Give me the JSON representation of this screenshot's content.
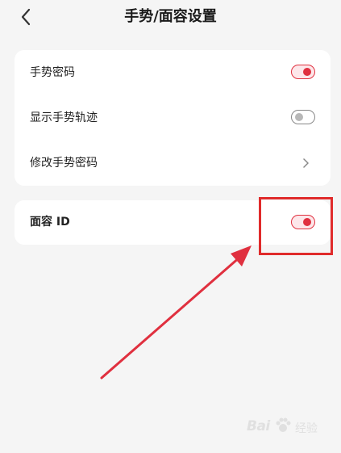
{
  "header": {
    "title": "手势/面容设置",
    "back_icon": "chevron-left-icon"
  },
  "settings": {
    "gesture_password": {
      "label": "手势密码",
      "toggle": "on"
    },
    "show_gesture_trail": {
      "label": "显示手势轨迹",
      "toggle": "off"
    },
    "change_gesture_password": {
      "label": "修改手势密码",
      "icon": "chevron-right-icon"
    },
    "face_id": {
      "label": "面容 ID",
      "toggle": "on"
    }
  },
  "annotation": {
    "highlight_color": "#e02b2b",
    "arrow_color": "#e0303f"
  },
  "watermark": {
    "brand": "Bai",
    "suffix": "经验"
  },
  "colors": {
    "accent": "#e0303f",
    "background": "#f5f5f5",
    "card": "#ffffff"
  }
}
